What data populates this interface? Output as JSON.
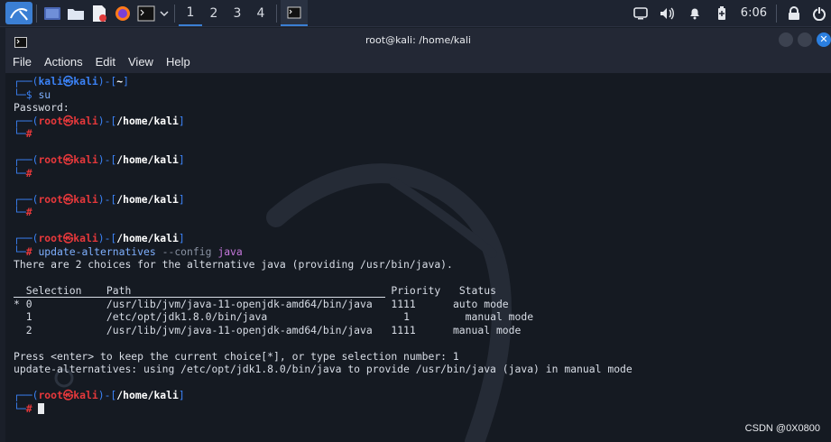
{
  "taskbar": {
    "workspaces": [
      "1",
      "2",
      "3",
      "4"
    ],
    "clock": "6:06"
  },
  "window": {
    "title": "root@kali: /home/kali",
    "menu": [
      "File",
      "Actions",
      "Edit",
      "View",
      "Help"
    ]
  },
  "terminal": {
    "kali_user": "kali",
    "kali_host": "kali",
    "home_path": "~",
    "root_user": "root",
    "root_host": "kali",
    "root_path": "/home/kali",
    "cmd_su": "su",
    "password_prompt": "Password:",
    "cmd_update_name": "update-alternatives",
    "cmd_update_flag": "--config",
    "cmd_update_arg": "java",
    "choices_line": "There are 2 choices for the alternative java (providing /usr/bin/java).",
    "table": {
      "headers": [
        "Selection",
        "Path",
        "Priority",
        "Status"
      ],
      "rows": [
        [
          "* 0",
          "/usr/lib/jvm/java-11-openjdk-amd64/bin/java",
          "1111",
          "auto mode"
        ],
        [
          "  1",
          "/etc/opt/jdk1.8.0/bin/java",
          "1",
          "manual mode"
        ],
        [
          "  2",
          "/usr/lib/jvm/java-11-openjdk-amd64/bin/java",
          "1111",
          "manual mode"
        ]
      ]
    },
    "press_line": "Press <enter> to keep the current choice[*], or type selection number: 1",
    "result_line": "update-alternatives: using /etc/opt/jdk1.8.0/bin/java to provide /usr/bin/java (java) in manual mode"
  },
  "watermark": "CSDN @0X0800"
}
